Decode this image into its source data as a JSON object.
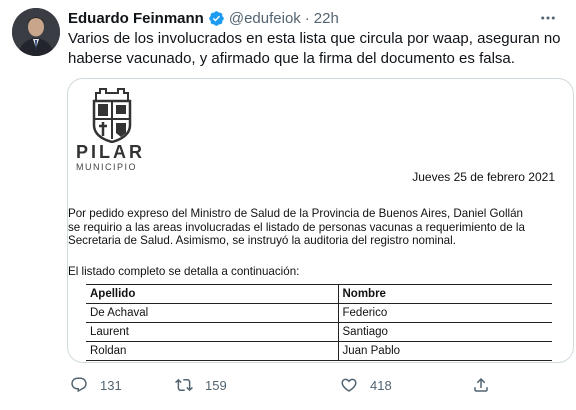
{
  "author": {
    "name": "Eduardo Feinmann",
    "handle": "@edufeiok",
    "time": "22h",
    "verified_color": "#1d9bf0"
  },
  "tweet": {
    "text": "Varios de los involucrados en esta lista que circula por waap, aseguran no haberse vacunado, y afirmado que la firma del documento es falsa."
  },
  "document": {
    "brand": "PILAR",
    "brand_sub": "MUNICIPIO",
    "date": "Jueves 25  de febrero 2021",
    "paragraph_lines": [
      "Por pedido expreso del Ministro de Salud de la Provincia de Buenos Aires, Daniel Gollán",
      "se requirio a las areas involucradas el listado de personas vacunas a requerimiento de la",
      "Secretaria de Salud. Asimismo, se instruyó la auditoria del registro nominal."
    ],
    "intro": "El listado completo se detalla a continuación:",
    "table": {
      "headers": [
        "Apellido",
        "Nombre"
      ],
      "rows": [
        [
          "De Achaval",
          "Federico"
        ],
        [
          "Laurent",
          "Santiago"
        ],
        [
          "Roldan",
          "Juan Pablo"
        ]
      ]
    }
  },
  "actions": {
    "replies": "131",
    "retweets": "159",
    "likes": "418"
  },
  "icons": {
    "verified": "verified-badge-icon",
    "more": "more-options-icon",
    "reply": "reply-icon",
    "retweet": "retweet-icon",
    "like": "heart-icon",
    "share": "share-icon"
  }
}
